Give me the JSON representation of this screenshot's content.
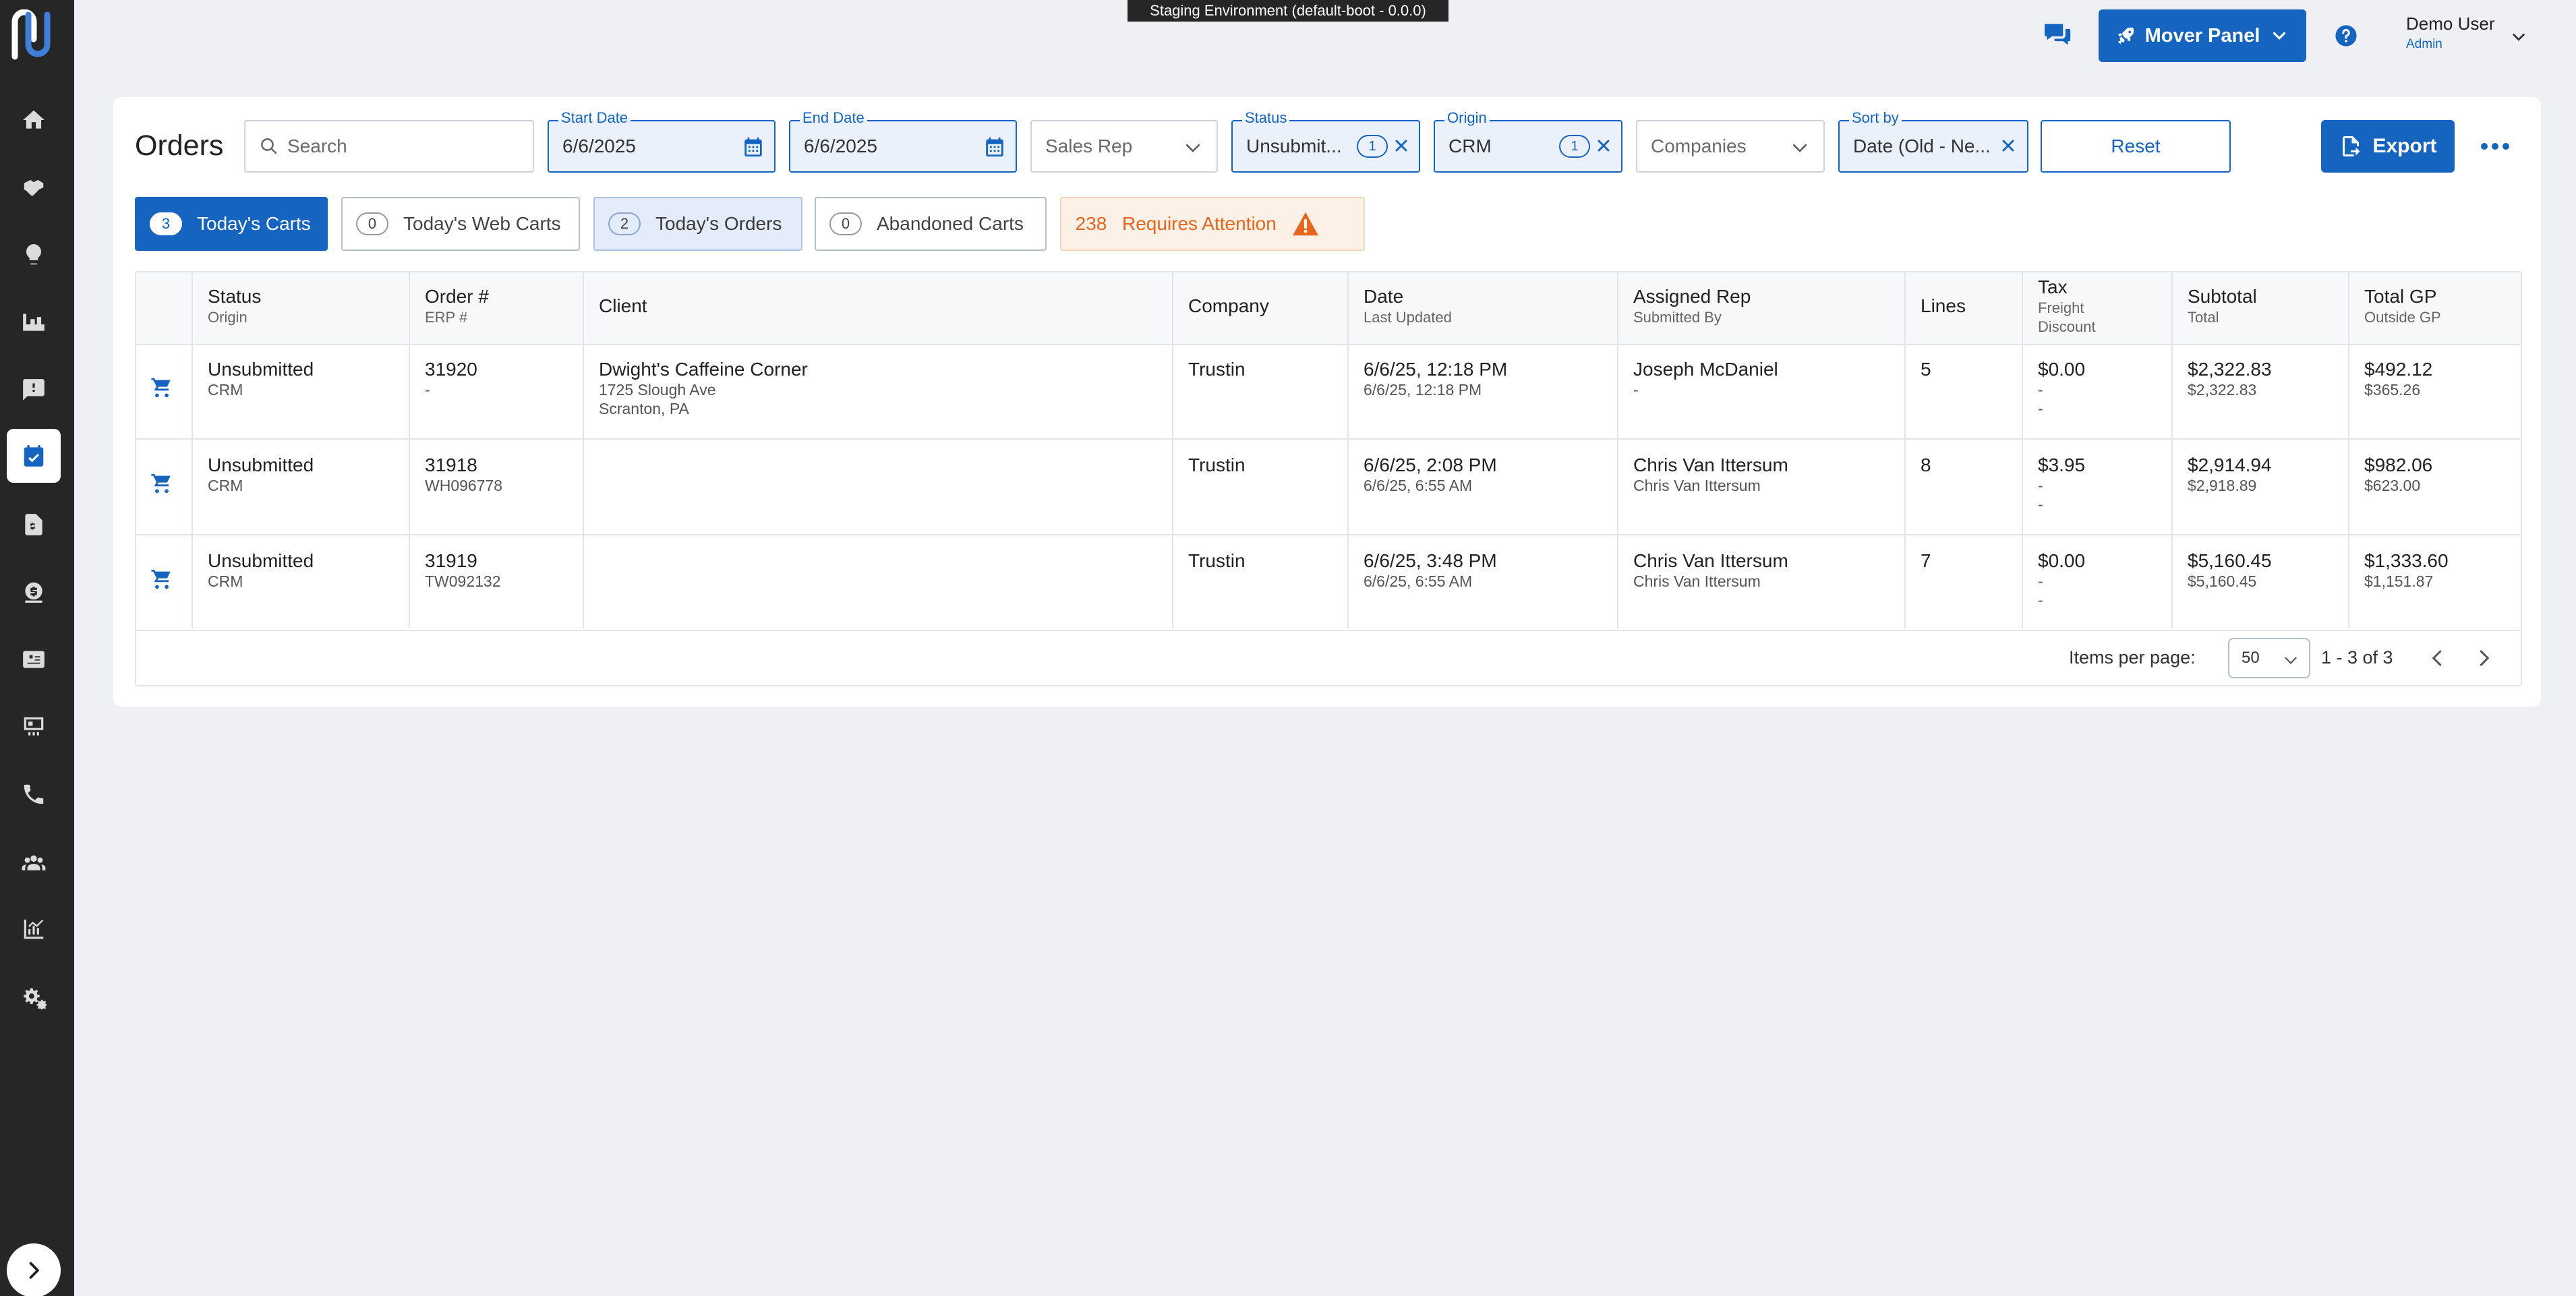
{
  "environment_banner": "Staging Environment (default-boot - 0.0.0)",
  "header": {
    "mover_panel_label": "Mover Panel",
    "user_name": "Demo User",
    "user_role": "Admin"
  },
  "sidebar": {
    "items": [
      {
        "icon": "home-icon"
      },
      {
        "icon": "handshake-icon"
      },
      {
        "icon": "lightbulb-icon"
      },
      {
        "icon": "warehouse-icon"
      },
      {
        "icon": "feedback-icon"
      },
      {
        "icon": "calendar-check-icon",
        "active": true
      },
      {
        "icon": "invoice-icon"
      },
      {
        "icon": "money-icon"
      },
      {
        "icon": "id-card-icon"
      },
      {
        "icon": "dashboard-icon"
      },
      {
        "icon": "phone-icon"
      },
      {
        "icon": "people-icon"
      },
      {
        "icon": "analytics-icon"
      },
      {
        "icon": "settings-icon"
      }
    ]
  },
  "page": {
    "title": "Orders"
  },
  "filters": {
    "search_placeholder": "Search",
    "start_date_label": "Start Date",
    "start_date_value": "6/6/2025",
    "end_date_label": "End Date",
    "end_date_value": "6/6/2025",
    "sales_rep_placeholder": "Sales Rep",
    "status_label": "Status",
    "status_value": "Unsubmit...",
    "status_count": "1",
    "origin_label": "Origin",
    "origin_value": "CRM",
    "origin_count": "1",
    "companies_placeholder": "Companies",
    "sort_label": "Sort by",
    "sort_value": "Date (Old - Ne...",
    "reset_label": "Reset",
    "export_label": "Export"
  },
  "chips": [
    {
      "count": "3",
      "label": "Today's Carts"
    },
    {
      "count": "0",
      "label": "Today's Web Carts"
    },
    {
      "count": "2",
      "label": "Today's Orders"
    },
    {
      "count": "0",
      "label": "Abandoned Carts"
    },
    {
      "count": "238",
      "label": "Requires Attention"
    }
  ],
  "table": {
    "headers": {
      "status": "Status",
      "status_sub": "Origin",
      "order": "Order #",
      "order_sub": "ERP #",
      "client": "Client",
      "company": "Company",
      "date": "Date",
      "date_sub": "Last Updated",
      "rep": "Assigned Rep",
      "rep_sub": "Submitted By",
      "lines": "Lines",
      "tax": "Tax",
      "tax_sub1": "Freight",
      "tax_sub2": "Discount",
      "subtotal": "Subtotal",
      "subtotal_sub": "Total",
      "gp": "Total GP",
      "gp_sub": "Outside GP"
    },
    "rows": [
      {
        "status": "Unsubmitted",
        "origin": "CRM",
        "order": "31920",
        "erp": "-",
        "client": "Dwight's Caffeine Corner",
        "address1": "1725 Slough Ave",
        "address2": "Scranton, PA",
        "company": "Trustin",
        "date": "6/6/25, 12:18 PM",
        "updated": "6/6/25, 12:18 PM",
        "rep": "Joseph McDaniel",
        "submitted_by": "-",
        "lines": "5",
        "tax": "$0.00",
        "freight": "-",
        "discount": "-",
        "subtotal": "$2,322.83",
        "total": "$2,322.83",
        "gp": "$492.12",
        "outside_gp": "$365.26"
      },
      {
        "status": "Unsubmitted",
        "origin": "CRM",
        "order": "31918",
        "erp": "WH096778",
        "client": "",
        "address1": "",
        "address2": "",
        "company": "Trustin",
        "date": "6/6/25, 2:08 PM",
        "updated": "6/6/25, 6:55 AM",
        "rep": "Chris Van Ittersum",
        "submitted_by": "Chris Van Ittersum",
        "lines": "8",
        "tax": "$3.95",
        "freight": "-",
        "discount": "-",
        "subtotal": "$2,914.94",
        "total": "$2,918.89",
        "gp": "$982.06",
        "outside_gp": "$623.00"
      },
      {
        "status": "Unsubmitted",
        "origin": "CRM",
        "order": "31919",
        "erp": "TW092132",
        "client": "",
        "address1": "",
        "address2": "",
        "company": "Trustin",
        "date": "6/6/25, 3:48 PM",
        "updated": "6/6/25, 6:55 AM",
        "rep": "Chris Van Ittersum",
        "submitted_by": "Chris Van Ittersum",
        "lines": "7",
        "tax": "$0.00",
        "freight": "-",
        "discount": "-",
        "subtotal": "$5,160.45",
        "total": "$5,160.45",
        "gp": "$1,333.60",
        "outside_gp": "$1,151.87"
      }
    ]
  },
  "pagination": {
    "items_per_page_label": "Items per page:",
    "items_per_page_value": "50",
    "range": "1 - 3 of 3"
  },
  "colors": {
    "primary": "#1565c0",
    "sidebar": "#262626",
    "warning": "#e8651c"
  }
}
